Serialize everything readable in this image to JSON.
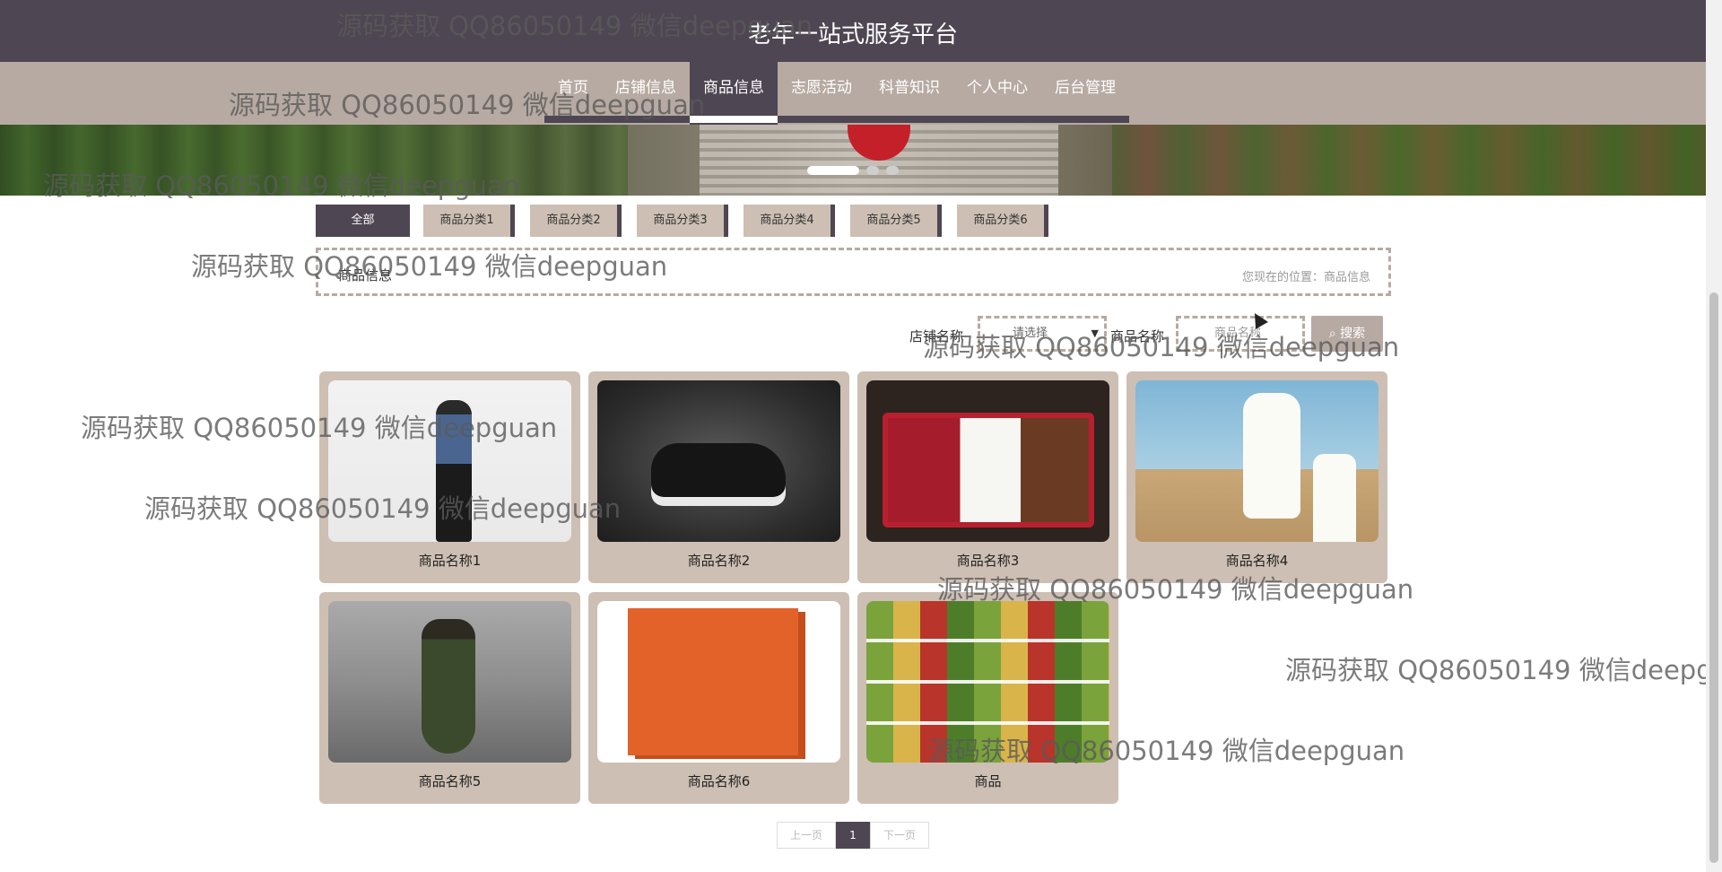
{
  "header": {
    "title": "老年一站式服务平台"
  },
  "nav": {
    "items": [
      {
        "label": "首页"
      },
      {
        "label": "店铺信息"
      },
      {
        "label": "商品信息"
      },
      {
        "label": "志愿活动"
      },
      {
        "label": "科普知识"
      },
      {
        "label": "个人中心"
      },
      {
        "label": "后台管理"
      }
    ],
    "active": "商品信息"
  },
  "categories": [
    {
      "label": "全部"
    },
    {
      "label": "商品分类1"
    },
    {
      "label": "商品分类2"
    },
    {
      "label": "商品分类3"
    },
    {
      "label": "商品分类4"
    },
    {
      "label": "商品分类5"
    },
    {
      "label": "商品分类6"
    }
  ],
  "breadcrumb": {
    "title": "商品信息",
    "location": "您现在的位置：商品信息"
  },
  "search": {
    "shop_label": "店铺名称",
    "shop_select_value": "请选择",
    "name_label": "商品名称",
    "name_placeholder": "商品名称",
    "button_label": "搜索"
  },
  "products": [
    {
      "name": "商品名称1"
    },
    {
      "name": "商品名称2"
    },
    {
      "name": "商品名称3"
    },
    {
      "name": "商品名称4"
    },
    {
      "name": "商品名称5"
    },
    {
      "name": "商品名称6"
    },
    {
      "name": "商品"
    }
  ],
  "pagination": {
    "prev": "上一页",
    "current": "1",
    "next": "下一页"
  },
  "watermark": {
    "text": "源码获取 QQ86050149 微信deepguan"
  },
  "icons": {
    "search": "search-icon",
    "dropdown": "chevron-down-icon"
  },
  "colors": {
    "primary": "#4e4652",
    "accent": "#b7aaa2",
    "card": "#cdbfb3"
  }
}
